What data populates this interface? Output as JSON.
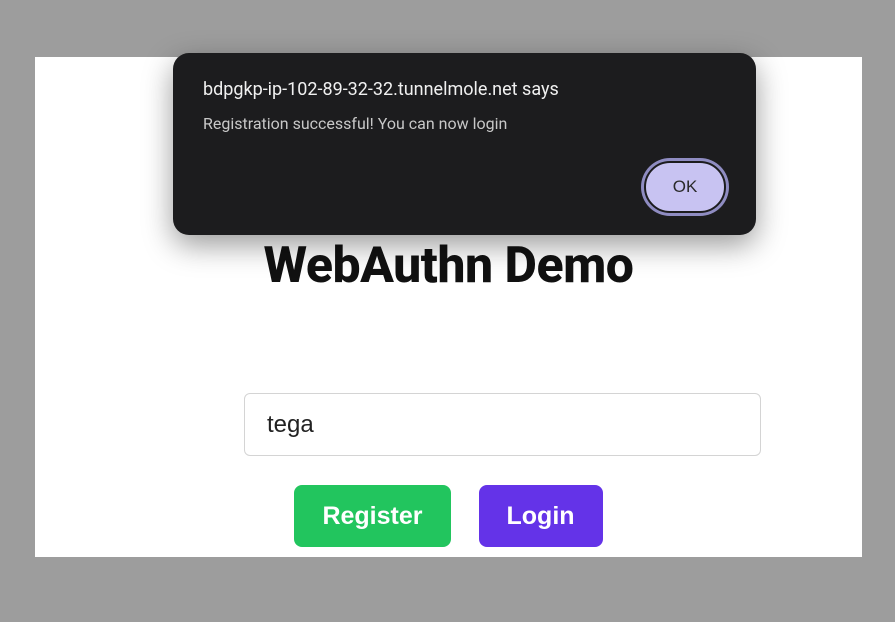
{
  "page": {
    "title": "WebAuthn Demo"
  },
  "form": {
    "username_value": "tega",
    "register_label": "Register",
    "login_label": "Login"
  },
  "alert": {
    "origin": "bdpgkp-ip-102-89-32-32.tunnelmole.net says",
    "message": "Registration successful! You can now login",
    "ok_label": "OK"
  },
  "colors": {
    "page_bg": "#9d9d9d",
    "card_bg": "#ffffff",
    "register_btn": "#22c55e",
    "login_btn": "#6433e8",
    "dialog_bg": "#1c1c1e",
    "ok_btn_bg": "#c8c3f2"
  }
}
